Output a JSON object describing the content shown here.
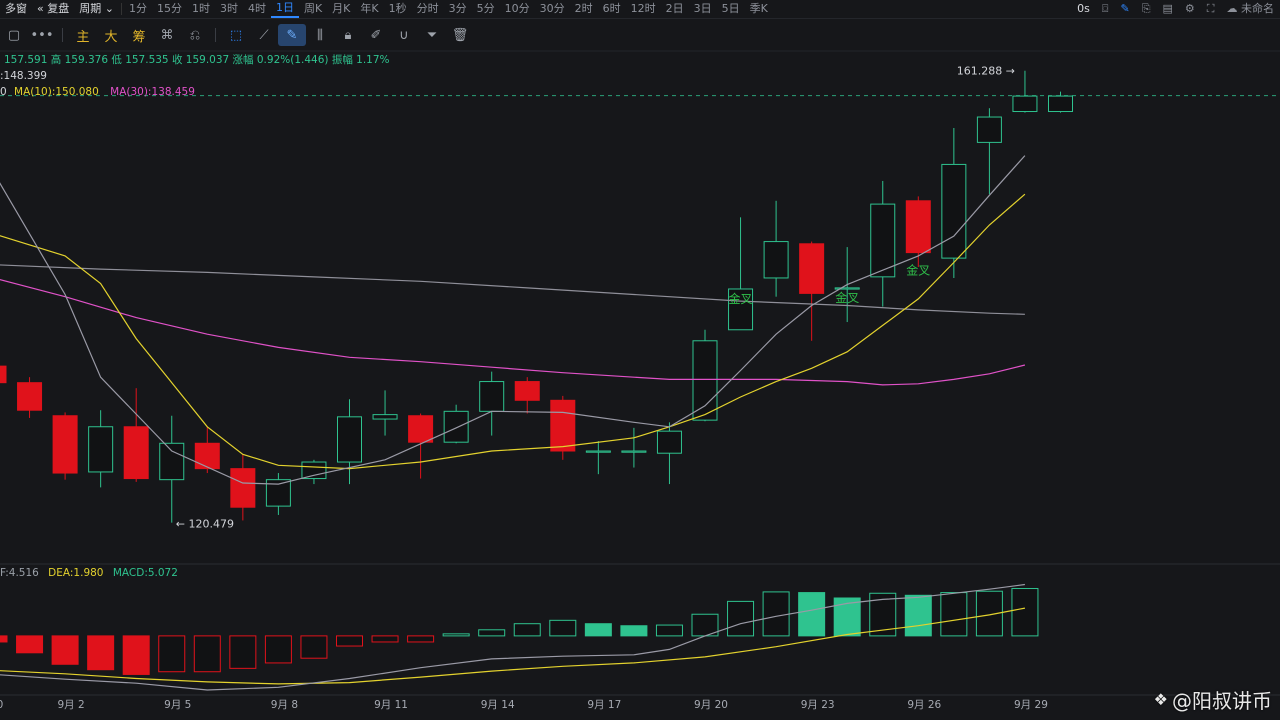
{
  "topbar": {
    "left": [
      "多窗",
      "复盘",
      "周期"
    ],
    "periods": [
      "1分",
      "15分",
      "1时",
      "3时",
      "4时",
      "1日",
      "周K",
      "月K",
      "年K",
      "1秒",
      "分时",
      "3分",
      "5分",
      "10分",
      "30分",
      "2时",
      "6时",
      "12时",
      "2日",
      "3日",
      "5日",
      "季K"
    ],
    "active_period": "1日",
    "right_text": "0s",
    "right_end": "未命名"
  },
  "toolbar": {
    "zhu": "主",
    "da": "大",
    "chou": "筹",
    "more": "•••"
  },
  "info": {
    "ohlc_line": "157.591  高 159.376  低 157.535  收 159.037  涨幅 0.92%(1.446)  振幅 1.17%",
    "ma_line1": ":148.399",
    "ma_line2_prefix": "0",
    "ma10": "MA(10):150.080",
    "ma30": "MA(30):138.459",
    "macd_dif": "F:4.516",
    "macd_dea": "DEA:1.980",
    "macd_val": "MACD:5.072"
  },
  "colors": {
    "up": "#2fc38f",
    "down": "#e0121b",
    "ma_short": "#9a9aa6",
    "ma10": "#e3d22e",
    "ma30": "#e052c8",
    "dif": "#9a9aa6",
    "dea": "#e3d22e",
    "grid": "#24262b"
  },
  "chart_data": {
    "type": "candlestick",
    "price_axis": {
      "min": 118,
      "max": 163
    },
    "high_label": "161.288",
    "low_label": "120.479",
    "golden_cross_label": "金叉",
    "golden_cross_days": [
      21,
      24,
      26
    ],
    "x_ticks": [
      {
        "i": 0,
        "label": "0"
      },
      {
        "i": 2,
        "label": "9月 2"
      },
      {
        "i": 5,
        "label": "9月 5"
      },
      {
        "i": 8,
        "label": "9月 8"
      },
      {
        "i": 11,
        "label": "9月 11"
      },
      {
        "i": 14,
        "label": "9月 14"
      },
      {
        "i": 17,
        "label": "9月 17"
      },
      {
        "i": 20,
        "label": "9月 20"
      },
      {
        "i": 23,
        "label": "9月 23"
      },
      {
        "i": 26,
        "label": "9月 26"
      },
      {
        "i": 29,
        "label": "9月 29"
      }
    ],
    "candles": [
      {
        "o": 134.5,
        "h": 135.0,
        "c": 133.0,
        "l": 132.0
      },
      {
        "o": 133.0,
        "h": 133.5,
        "c": 130.5,
        "l": 129.8
      },
      {
        "o": 130.0,
        "h": 130.3,
        "c": 124.8,
        "l": 124.2
      },
      {
        "o": 124.9,
        "h": 130.5,
        "c": 129.0,
        "l": 123.5
      },
      {
        "o": 129.0,
        "h": 132.5,
        "c": 124.3,
        "l": 124.0
      },
      {
        "o": 124.2,
        "h": 130.0,
        "c": 127.5,
        "l": 120.3
      },
      {
        "o": 127.5,
        "h": 129.0,
        "c": 125.2,
        "l": 124.8
      },
      {
        "o": 125.2,
        "h": 126.5,
        "c": 121.7,
        "l": 120.5
      },
      {
        "o": 121.8,
        "h": 124.8,
        "c": 124.2,
        "l": 121.0
      },
      {
        "o": 124.3,
        "h": 126.0,
        "c": 125.8,
        "l": 123.8
      },
      {
        "o": 125.8,
        "h": 131.5,
        "c": 129.9,
        "l": 123.8
      },
      {
        "o": 129.7,
        "h": 132.3,
        "c": 130.1,
        "l": 128.2
      },
      {
        "o": 130.0,
        "h": 130.2,
        "c": 127.6,
        "l": 124.3
      },
      {
        "o": 127.6,
        "h": 131.0,
        "c": 130.4,
        "l": 127.5
      },
      {
        "o": 130.4,
        "h": 134.0,
        "c": 133.1,
        "l": 128.2
      },
      {
        "o": 133.1,
        "h": 133.5,
        "c": 131.4,
        "l": 130.2
      },
      {
        "o": 131.4,
        "h": 131.8,
        "c": 126.8,
        "l": 126.0
      },
      {
        "o": 126.8,
        "h": 127.7,
        "c": 126.8,
        "l": 124.7
      },
      {
        "o": 126.8,
        "h": 128.9,
        "c": 126.8,
        "l": 125.3
      },
      {
        "o": 126.6,
        "h": 129.4,
        "c": 128.6,
        "l": 123.8
      },
      {
        "o": 129.6,
        "h": 137.8,
        "c": 136.8,
        "l": 129.5
      },
      {
        "o": 137.8,
        "h": 148.0,
        "c": 141.5,
        "l": 137.8
      },
      {
        "o": 142.5,
        "h": 149.5,
        "c": 145.8,
        "l": 140.8
      },
      {
        "o": 145.6,
        "h": 145.8,
        "c": 141.1,
        "l": 136.8
      },
      {
        "o": 141.6,
        "h": 145.3,
        "c": 141.6,
        "l": 138.5
      },
      {
        "o": 142.6,
        "h": 151.3,
        "c": 149.2,
        "l": 139.9
      },
      {
        "o": 149.5,
        "h": 149.9,
        "c": 144.8,
        "l": 143.5
      },
      {
        "o": 144.3,
        "h": 156.1,
        "c": 152.8,
        "l": 142.5
      },
      {
        "o": 154.8,
        "h": 157.9,
        "c": 157.1,
        "l": 150.1
      },
      {
        "o": 157.6,
        "h": 161.3,
        "c": 159.0,
        "l": 157.5
      },
      {
        "o": 157.6,
        "h": 159.4,
        "c": 159.0,
        "l": 157.5
      }
    ],
    "last_close_price": 159.037,
    "ma_short": [
      [
        0,
        152.0
      ],
      [
        2,
        141.0
      ],
      [
        3,
        133.5
      ],
      [
        5,
        126.8
      ],
      [
        7,
        123.9
      ],
      [
        8,
        123.8
      ],
      [
        9,
        124.6
      ],
      [
        11,
        126.0
      ],
      [
        13,
        128.9
      ],
      [
        14,
        130.4
      ],
      [
        16,
        130.3
      ],
      [
        18,
        129.4
      ],
      [
        19,
        129.0
      ],
      [
        20,
        130.9
      ],
      [
        21,
        134.1
      ],
      [
        22,
        137.4
      ],
      [
        23,
        140.0
      ],
      [
        24,
        141.9
      ],
      [
        25,
        143.2
      ],
      [
        26,
        144.5
      ],
      [
        27,
        146.3
      ],
      [
        28,
        150.0
      ],
      [
        29,
        153.6
      ]
    ],
    "ma10": [
      [
        0,
        146.5
      ],
      [
        2,
        144.5
      ],
      [
        3,
        142.0
      ],
      [
        4,
        137.0
      ],
      [
        5,
        133.0
      ],
      [
        6,
        129.0
      ],
      [
        7,
        126.5
      ],
      [
        8,
        125.5
      ],
      [
        10,
        125.2
      ],
      [
        12,
        125.8
      ],
      [
        14,
        126.8
      ],
      [
        16,
        127.2
      ],
      [
        18,
        128.0
      ],
      [
        19,
        129.0
      ],
      [
        20,
        130.1
      ],
      [
        21,
        131.7
      ],
      [
        22,
        133.1
      ],
      [
        23,
        134.3
      ],
      [
        24,
        135.8
      ],
      [
        25,
        138.2
      ],
      [
        26,
        140.6
      ],
      [
        27,
        143.9
      ],
      [
        28,
        147.3
      ],
      [
        29,
        150.1
      ]
    ],
    "ma30": [
      [
        0,
        142.5
      ],
      [
        2,
        140.8
      ],
      [
        4,
        138.9
      ],
      [
        6,
        137.4
      ],
      [
        8,
        136.2
      ],
      [
        10,
        135.3
      ],
      [
        12,
        134.9
      ],
      [
        14,
        134.4
      ],
      [
        16,
        133.9
      ],
      [
        18,
        133.5
      ],
      [
        19,
        133.3
      ],
      [
        20,
        133.3
      ],
      [
        22,
        133.3
      ],
      [
        23,
        133.2
      ],
      [
        24,
        133.1
      ],
      [
        25,
        132.8
      ],
      [
        26,
        132.9
      ],
      [
        27,
        133.3
      ],
      [
        28,
        133.8
      ],
      [
        29,
        134.6
      ]
    ],
    "ma_long": [
      [
        0,
        143.7
      ],
      [
        3,
        143.3
      ],
      [
        6,
        143.0
      ],
      [
        9,
        142.6
      ],
      [
        12,
        142.2
      ],
      [
        15,
        141.6
      ],
      [
        18,
        141.0
      ],
      [
        21,
        140.4
      ],
      [
        24,
        140.0
      ],
      [
        26,
        139.6
      ],
      [
        28,
        139.3
      ],
      [
        29,
        139.2
      ]
    ],
    "macd_axis": {
      "min": -8,
      "max": 9
    },
    "macd": [
      -0.9,
      -2.5,
      -4.2,
      -5.0,
      -5.7,
      -5.3,
      -5.3,
      -4.8,
      -4.0,
      -3.3,
      -1.5,
      -0.9,
      -0.9,
      0.3,
      0.9,
      1.8,
      2.3,
      1.8,
      1.5,
      1.6,
      3.2,
      5.1,
      6.5,
      6.4,
      5.6,
      6.3,
      6.0,
      6.4,
      6.6,
      7.0
    ],
    "dif": [
      [
        0,
        -5.7
      ],
      [
        2,
        -6.4
      ],
      [
        4,
        -7.0
      ],
      [
        6,
        -8.0
      ],
      [
        8,
        -7.6
      ],
      [
        10,
        -6.3
      ],
      [
        12,
        -4.7
      ],
      [
        14,
        -3.4
      ],
      [
        16,
        -3.0
      ],
      [
        18,
        -2.8
      ],
      [
        19,
        -2.0
      ],
      [
        20,
        0.0
      ],
      [
        21,
        1.8
      ],
      [
        22,
        2.9
      ],
      [
        23,
        3.8
      ],
      [
        24,
        4.8
      ],
      [
        25,
        5.4
      ],
      [
        26,
        5.7
      ],
      [
        27,
        6.3
      ],
      [
        28,
        6.9
      ],
      [
        29,
        7.6
      ]
    ],
    "dea": [
      [
        0,
        -5.1
      ],
      [
        2,
        -5.6
      ],
      [
        4,
        -6.3
      ],
      [
        6,
        -6.8
      ],
      [
        8,
        -7.1
      ],
      [
        10,
        -6.9
      ],
      [
        12,
        -6.1
      ],
      [
        14,
        -5.2
      ],
      [
        16,
        -4.5
      ],
      [
        18,
        -4.0
      ],
      [
        20,
        -3.1
      ],
      [
        22,
        -1.6
      ],
      [
        24,
        0.2
      ],
      [
        26,
        1.5
      ],
      [
        28,
        3.1
      ],
      [
        29,
        4.1
      ]
    ]
  },
  "watermark": {
    "text": "@阳叔讲币"
  }
}
